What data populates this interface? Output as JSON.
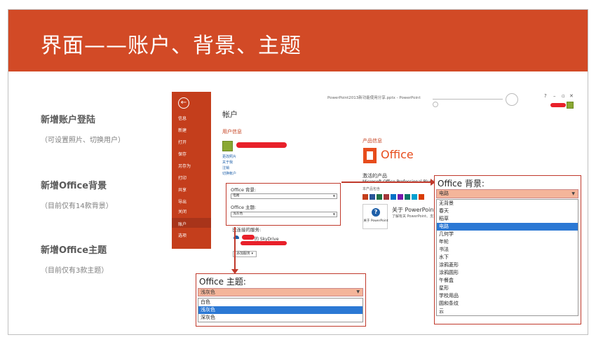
{
  "slide": {
    "title": "界面——账户、背景、主题",
    "features": [
      {
        "title": "新增账户登陆",
        "note": "（可设置照片、切换用户）"
      },
      {
        "title": "新增Office背景",
        "note": "（目前仅有14款背景）"
      },
      {
        "title": "新增Office主题",
        "note": "（目前仅有3款主题）"
      }
    ]
  },
  "ppt": {
    "window_title": "PowerPoint2013新功能使用分享.pptx - PowerPoint",
    "win_controls": {
      "help": "?",
      "minimize": "–",
      "restore": "▫",
      "close": "✕"
    },
    "nav": [
      "信息",
      "新建",
      "打开",
      "保存",
      "另存为",
      "打印",
      "共享",
      "导出",
      "关闭",
      "账户",
      "选项"
    ],
    "nav_selected": "账户",
    "page_title": "帐户",
    "user_info_heading": "用户信息",
    "user_links": [
      "更改照片",
      "关于我",
      "注销",
      "切换帐户"
    ],
    "office_bg_label": "Office 背景:",
    "office_bg_value": "电路",
    "office_theme_label": "Office 主题:",
    "office_theme_value": "浅灰色",
    "connected_services": "已连接的服务:",
    "skydrive_label": "的 SkyDrive",
    "add_service": "添加服务 ▾",
    "product_heading": "产品信息",
    "office_brand": "Office",
    "activated": "激活的产品",
    "product_name": "Microsoft Office Professional Plus 2013",
    "product_contains": "本产品包含",
    "about_button": "关于 PowerPoint",
    "about_heading": "关于 PowerPoint",
    "about_desc": "了解有关 PowerPoint、支持、..."
  },
  "background_dropdown": {
    "heading": "Office 背景:",
    "selected": "电路",
    "items": [
      "无背景",
      "春天",
      "稻草",
      "电路",
      "几何学",
      "年轮",
      "书法",
      "水下",
      "涂鸦菱形",
      "涂鸦圆形",
      "午餐盒",
      "星形",
      "学校用品",
      "圆和条纹",
      "云"
    ]
  },
  "theme_dropdown": {
    "heading": "Office 主题:",
    "selected": "浅灰色",
    "items": [
      "白色",
      "浅灰色",
      "深灰色"
    ]
  },
  "colors": {
    "brand": "#d24a26",
    "selection": "#2b78d4",
    "dropdown_header": "#f4b59a"
  }
}
